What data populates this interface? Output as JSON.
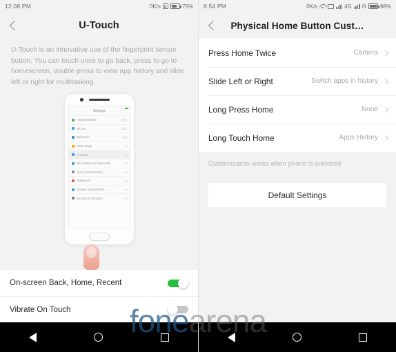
{
  "left": {
    "statusbar": {
      "time": "12:08 PM",
      "net_speed": "0K/s",
      "sim_icon": "sim-card-icon",
      "battery_icon": "battery-icon",
      "battery": "75%"
    },
    "header": {
      "back_icon": "chevron-left-icon",
      "title": "U-Touch"
    },
    "description": "U-Touch is an innovative use of the fingerprint sensor button. You can touch once to go back, press to go to homescreen, double press to view app history and slide left or right for multitasking.",
    "phone": {
      "camera_icon": "front-camera-icon",
      "speaker_icon": "earpiece-speaker-icon",
      "screen_title": "Settings",
      "home_button_icon": "home-button-icon",
      "fingerprint_icon": "finger-touch-icon",
      "settings_rows": [
        {
          "label": "Airplane Mode",
          "color": "#4caf50",
          "control": "toggle"
        },
        {
          "label": "WLAN",
          "color": "#30a8e0",
          "control": "switch"
        },
        {
          "label": "Bluetooth",
          "color": "#2f8fd8",
          "control": "switch"
        },
        {
          "label": "Data usage",
          "color": "#f5a623",
          "control": "chevron"
        },
        {
          "label": "U-Touch",
          "color": "#3aa0e8",
          "control": "chevron",
          "selected": true
        },
        {
          "label": "Nav Buttons & Status Bar",
          "color": "#3aa0e8",
          "control": "chevron"
        },
        {
          "label": "Quick Switch Panel",
          "color": "#8d8d8d",
          "control": "chevron"
        },
        {
          "label": "Wallpaper",
          "color": "#e8534a",
          "control": "chevron"
        },
        {
          "label": "Display & Brightness",
          "color": "#4f9ad8",
          "control": "chevron"
        },
        {
          "label": "Sounds & Vibration",
          "color": "#7f7f7f",
          "control": "chevron"
        }
      ]
    },
    "switches": [
      {
        "label": "On-screen Back, Home, Recent",
        "state": "on"
      },
      {
        "label": "Vibrate On Touch",
        "state": "off"
      }
    ],
    "accent_on": "#25c23e",
    "accent_off": "#c6c6c6"
  },
  "right": {
    "statusbar": {
      "time": "8:54 PM",
      "net_speed": "0K/s",
      "wifi_icon": "wifi-icon",
      "sim_icon": "sim-card-icon",
      "signal1_icon": "signal-bars-icon",
      "network1": "4G",
      "signal2_icon": "signal-bars-icon",
      "network2": "G",
      "battery_icon": "battery-icon",
      "battery": "98%"
    },
    "header": {
      "back_icon": "chevron-left-icon",
      "title": "Physical Home Button Cust…"
    },
    "rows": [
      {
        "label": "Press Home Twice",
        "value": "Camera"
      },
      {
        "label": "Slide Left or Right",
        "value": "Switch apps in history"
      },
      {
        "label": "Long Press Home",
        "value": "None"
      },
      {
        "label": "Long Touch Home",
        "value": "Apps History"
      }
    ],
    "note": "Customization works when phone is unlocked",
    "default_button": "Default Settings"
  },
  "navbar": {
    "back_icon": "triangle-back-icon",
    "home_icon": "circle-home-icon",
    "recent_icon": "square-recents-icon"
  },
  "watermark": {
    "part1": "fone",
    "part2": "arena"
  }
}
